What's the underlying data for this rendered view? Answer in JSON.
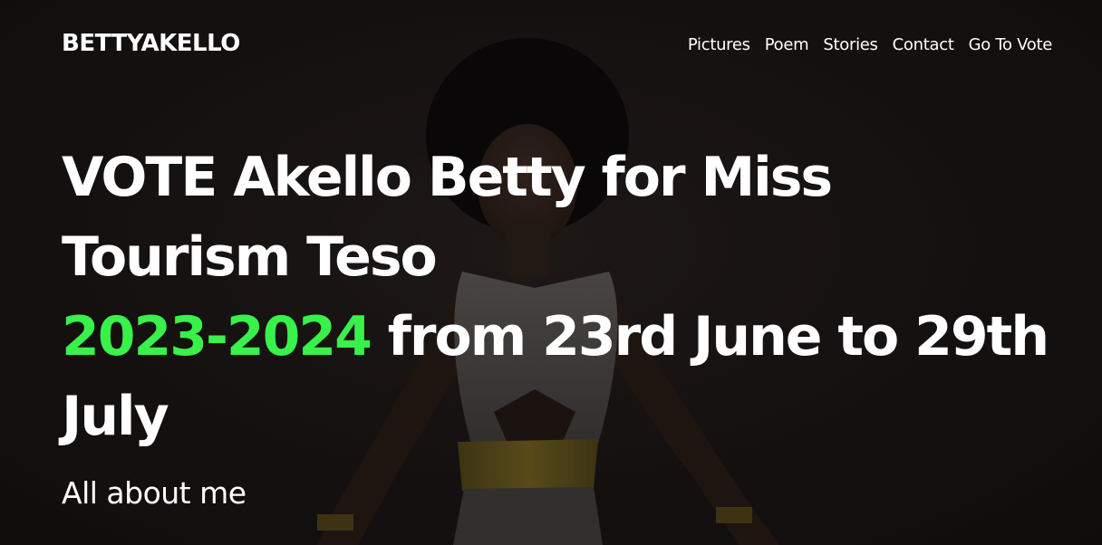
{
  "brand": {
    "part1": "BETTY",
    "part2": "AKELLO"
  },
  "nav": {
    "items": [
      {
        "label": "Pictures"
      },
      {
        "label": "Poem"
      },
      {
        "label": "Stories"
      },
      {
        "label": "Contact"
      },
      {
        "label": "Go To Vote"
      }
    ]
  },
  "hero": {
    "headline_part1": "VOTE Akello Betty for Miss Tourism Teso",
    "headline_accent": "2023-2024",
    "headline_part2": " from 23rd June to 29th July",
    "subtitle": "All about me"
  },
  "colors": {
    "accent": "#38f14a",
    "background": "#1a1615",
    "text": "#ffffff"
  }
}
